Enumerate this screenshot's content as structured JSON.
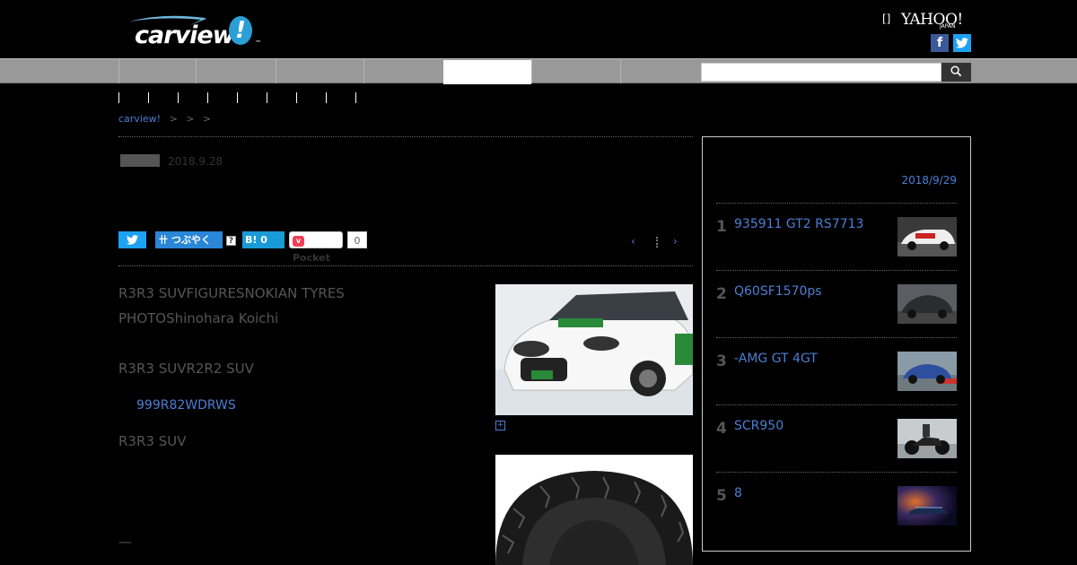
{
  "header": {
    "logo_word": "carview",
    "logo_bang": "!",
    "logo_tm": "™",
    "bracket": "[]",
    "yahoo": "YAHOO!",
    "yahoo_sub": "JAPAN",
    "facebook": "f",
    "twitter": "t"
  },
  "breadcrumb": {
    "home": "carview!",
    "sep1": ">",
    "sep2": ">",
    "sep3": ">"
  },
  "article": {
    "category": "",
    "date": "2018.9.28",
    "lines": [
      "R3R3 SUVFIGURESNOKIAN TYRES",
      "PHOTOShinohara Koichi",
      "R3R3 SUVR2R2 SUV",
      "R3R3 SUV"
    ],
    "link": "999R82WDRWS",
    "dash": "—"
  },
  "share": {
    "twitter": "t",
    "tsubuyaku": "つぶやく",
    "question": "?",
    "hatena": "B! 0",
    "pocket": "Pocket",
    "pocket_icon": "v",
    "pocket_count": "0"
  },
  "pager": {
    "prev": "‹",
    "next": "›"
  },
  "zoom": "+",
  "ranking": {
    "title": "",
    "date": "2018/9/29",
    "items": [
      {
        "num": "1",
        "text": "935911 GT2 RS7713"
      },
      {
        "num": "2",
        "text": "Q60SF1570ps"
      },
      {
        "num": "3",
        "text": "-AMG GT 4GT"
      },
      {
        "num": "4",
        "text": "SCR950"
      },
      {
        "num": "5",
        "text": "8"
      }
    ]
  },
  "colors": {
    "link": "#4a7fd4",
    "nav": "#999999",
    "background": "#000000"
  }
}
